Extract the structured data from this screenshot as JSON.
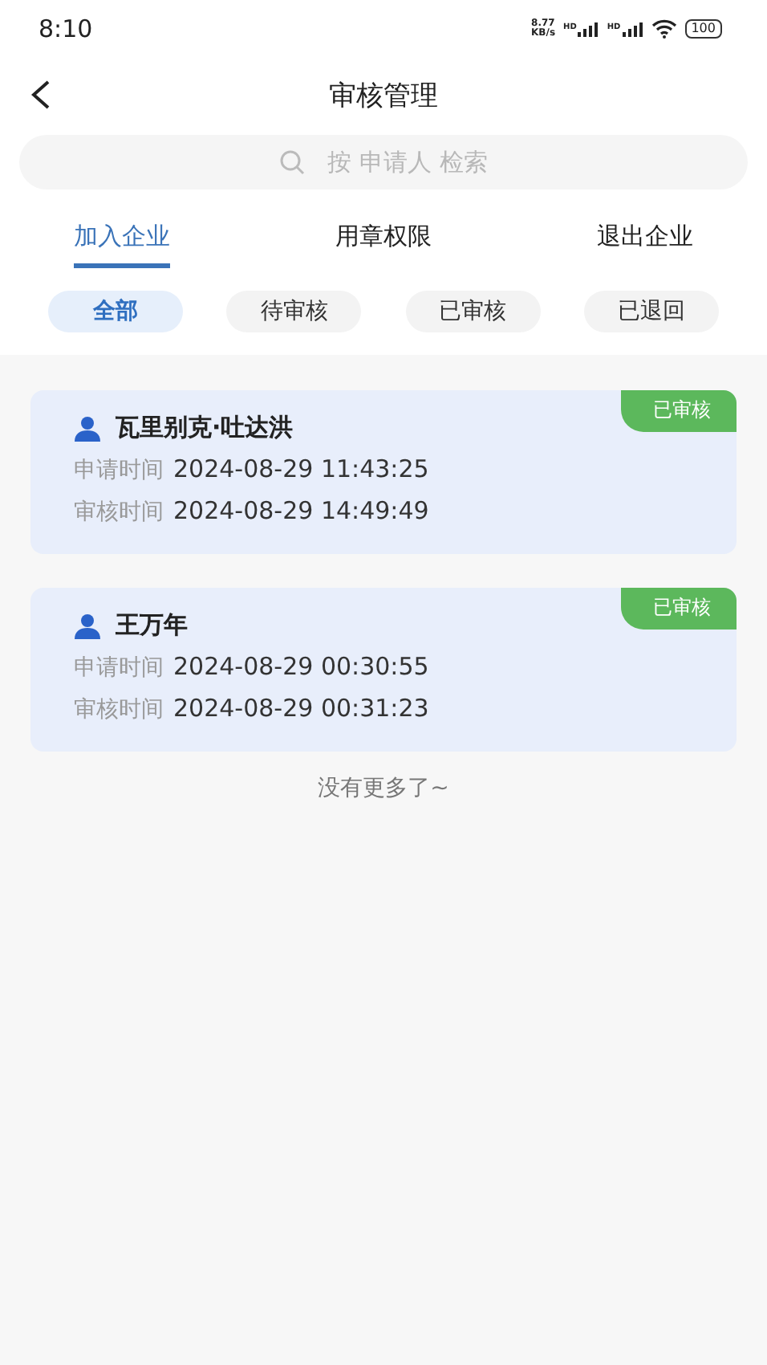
{
  "status_bar": {
    "time": "8:10",
    "speed_value": "8.77",
    "speed_unit": "KB/s",
    "sim_labels": [
      "HD",
      "HD"
    ],
    "battery": "100"
  },
  "header": {
    "title": "审核管理"
  },
  "search": {
    "placeholder": "按 申请人 检索"
  },
  "tabs": [
    {
      "label": "加入企业",
      "selected": true
    },
    {
      "label": "用章权限",
      "selected": false
    },
    {
      "label": "退出企业",
      "selected": false
    }
  ],
  "filters": [
    {
      "label": "全部",
      "selected": true
    },
    {
      "label": "待审核",
      "selected": false
    },
    {
      "label": "已审核",
      "selected": false
    },
    {
      "label": "已退回",
      "selected": false
    }
  ],
  "records": [
    {
      "name": "瓦里别克·吐达洪",
      "status": "已审核",
      "apply_label": "申请时间",
      "apply_time": "2024-08-29 11:43:25",
      "review_label": "审核时间",
      "review_time": "2024-08-29 14:49:49"
    },
    {
      "name": "王万年",
      "status": "已审核",
      "apply_label": "申请时间",
      "apply_time": "2024-08-29 00:30:55",
      "review_label": "审核时间",
      "review_time": "2024-08-29 00:31:23"
    }
  ],
  "footer_note": "没有更多了~"
}
